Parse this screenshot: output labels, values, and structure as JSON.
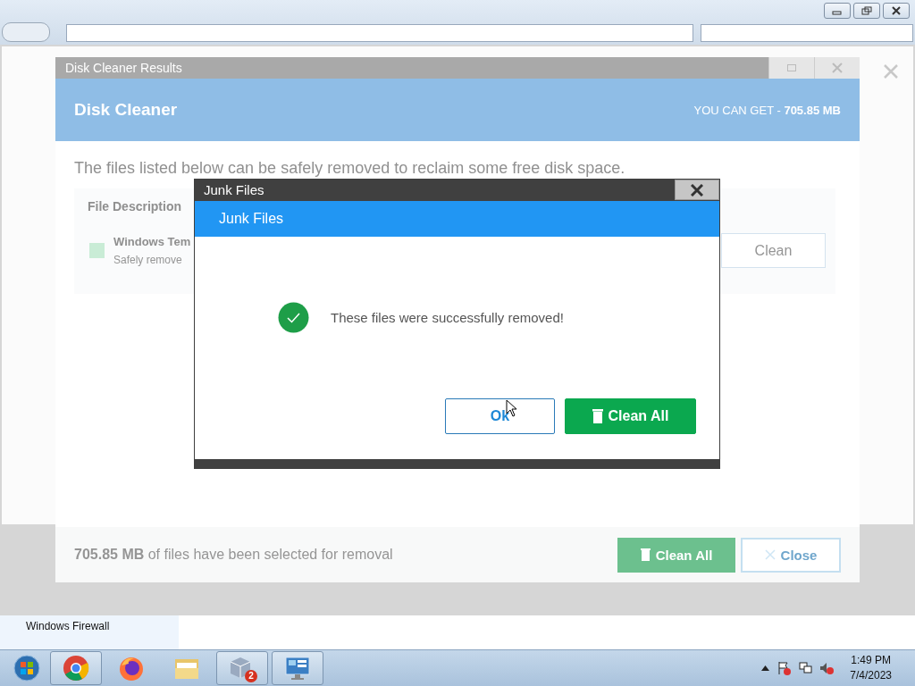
{
  "disk_cleaner": {
    "title": "Disk Cleaner Results",
    "header": "Disk Cleaner",
    "savings": "YOU CAN GET - **705.85 MB**",
    "intro": "The files listed below can be safely removed to reclaim some free disk space.",
    "column": "File Description",
    "items": [
      {
        "name": "Windows Tem",
        "description": "Safely remove",
        "checked": true,
        "button": "Clean"
      }
    ],
    "summary": "**705.85 MB** of files have been selected for removal",
    "buttons": [
      {
        "label": "Clean All",
        "kind": "primary"
      },
      {
        "label": "Close",
        "kind": "close"
      }
    ]
  },
  "dialog": {
    "title": "Junk Files",
    "header": "Junk Files",
    "message": "These files were successfully removed!",
    "buttons": [
      {
        "label": "Ok",
        "kind": "outline"
      },
      {
        "label": "Clean All",
        "kind": "primary"
      }
    ]
  },
  "background_panel": {
    "label": "Windows Firewall"
  },
  "taskbar": {
    "apps": [
      {
        "kind": "chrome",
        "active": true
      },
      {
        "kind": "firefox",
        "active": false
      },
      {
        "kind": "folder",
        "active": false
      },
      {
        "kind": "package",
        "active": true,
        "badge": "2"
      },
      {
        "kind": "panel",
        "active": true
      }
    ],
    "time": "1:49 PM",
    "date": "7/4/2023"
  }
}
